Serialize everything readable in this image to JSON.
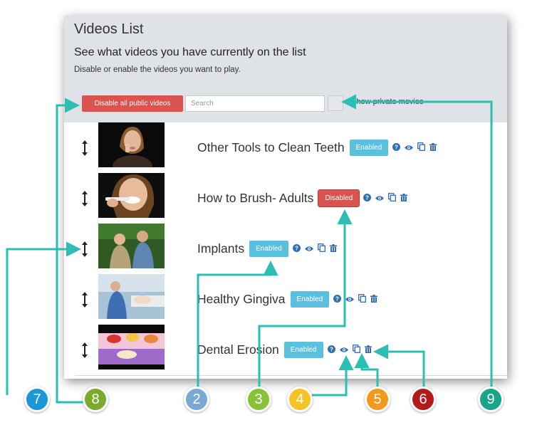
{
  "header": {
    "title": "Videos List",
    "subtitle": "See what videos you have currently on the list",
    "description": "Disable or enable the videos you want to play."
  },
  "toolbar": {
    "disable_all_label": "Disable all public videos",
    "search_placeholder": "Search",
    "toggle_label": "Show private movies"
  },
  "videos": [
    {
      "title": "Other Tools to Clean Teeth",
      "status": "Enabled"
    },
    {
      "title": "How to Brush- Adults",
      "status": "Disabled"
    },
    {
      "title": "Implants",
      "status": "Enabled"
    },
    {
      "title": "Healthy Gingiva",
      "status": "Enabled"
    },
    {
      "title": "Dental Erosion",
      "status": "Enabled"
    }
  ],
  "callouts": [
    {
      "label": "7",
      "color": "#1a97d6"
    },
    {
      "label": "8",
      "color": "#7aab2c"
    },
    {
      "label": "2",
      "color": "#7ba7d4"
    },
    {
      "label": "3",
      "color": "#86c436"
    },
    {
      "label": "4",
      "color": "#f5c326"
    },
    {
      "label": "5",
      "color": "#f39a1c"
    },
    {
      "label": "6",
      "color": "#b31b1b"
    },
    {
      "label": "9",
      "color": "#17a589"
    }
  ],
  "colors": {
    "enabled": "#5bc0de",
    "disabled": "#d9534f",
    "action_icons": "#2f6eb5",
    "arrows": "#2bbfb3"
  },
  "icons": [
    "drag-handle-icon",
    "help-icon",
    "eye-icon",
    "copy-icon",
    "trash-icon"
  ]
}
